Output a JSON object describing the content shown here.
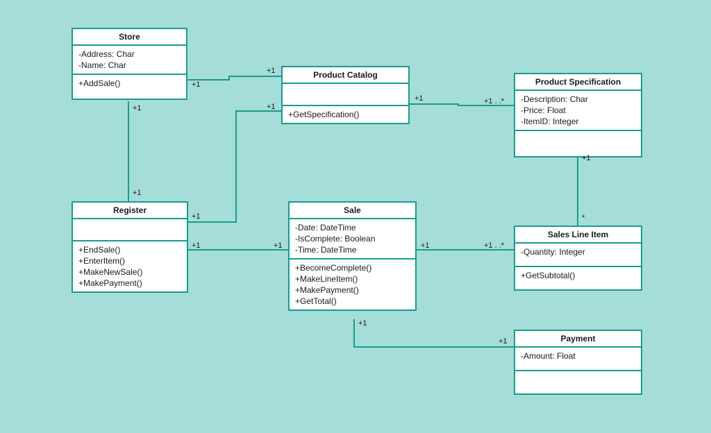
{
  "classes": {
    "store": {
      "name": "Store",
      "attributes": [
        "-Address: Char",
        "-Name: Char"
      ],
      "methods": [
        "+AddSale()"
      ]
    },
    "productCatalog": {
      "name": "Product Catalog",
      "attributes": [],
      "methods": [
        "+GetSpecification()"
      ]
    },
    "productSpecification": {
      "name": "Product Specification",
      "attributes": [
        "-Description: Char",
        "-Price: Float",
        "-ItemID: Integer"
      ],
      "methods": []
    },
    "register": {
      "name": "Register",
      "attributes": [],
      "methods": [
        "+EndSale()",
        "+EnterItem()",
        "+MakeNewSale()",
        "+MakePayment()"
      ]
    },
    "sale": {
      "name": "Sale",
      "attributes": [
        "-Date: DateTime",
        "-IsComplete: Boolean",
        "-Time: DateTime"
      ],
      "methods": [
        "+BecomeComplete()",
        "+MakeLineItem()",
        "+MakePayment()",
        "+GetTotal()"
      ]
    },
    "salesLineItem": {
      "name": "Sales Line Item",
      "attributes": [
        "-Quantity: Integer"
      ],
      "methods": [
        "+GetSubtotal()"
      ]
    },
    "payment": {
      "name": "Payment",
      "attributes": [
        "-Amount: Float"
      ],
      "methods": []
    }
  },
  "multiplicities": {
    "store_catalog_a": "+1",
    "store_catalog_b": "+1",
    "store_register_a": "+1",
    "store_register_b": "+1",
    "catalog_spec_a": "+1",
    "catalog_spec_b": "+1 . .*",
    "register_catalog_a": "+1",
    "register_catalog_b": "+1",
    "register_sale_a": "+1",
    "register_sale_b": "+1",
    "sale_lineitem_a": "+1",
    "sale_lineitem_b": "+1 . .*",
    "spec_lineitem_a": "+1",
    "spec_lineitem_b": "*",
    "sale_payment_a": "+1",
    "sale_payment_b": "+1"
  }
}
